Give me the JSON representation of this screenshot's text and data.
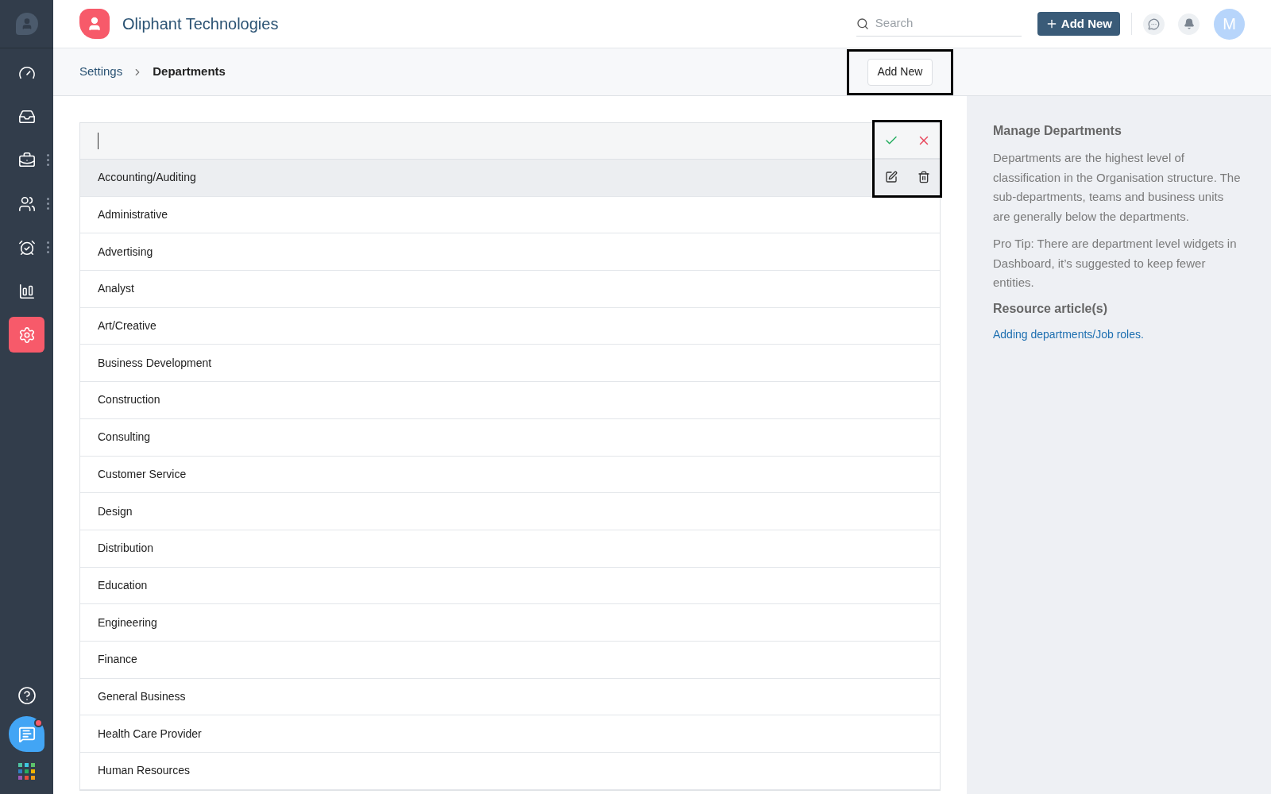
{
  "sidebar": {
    "items": [
      {
        "kind": "dashboard",
        "selected": false,
        "more": false
      },
      {
        "kind": "inbox",
        "selected": false,
        "more": false
      },
      {
        "kind": "briefcase",
        "selected": false,
        "more": true
      },
      {
        "kind": "people",
        "selected": false,
        "more": true
      },
      {
        "kind": "alarm",
        "selected": false,
        "more": true
      },
      {
        "kind": "reports",
        "selected": false,
        "more": false
      },
      {
        "kind": "settings",
        "selected": true,
        "more": false
      }
    ],
    "chat_unread": true
  },
  "header": {
    "company": "Oliphant Technologies",
    "search": {
      "placeholder": "Search"
    },
    "add_button": "Add New",
    "avatar": "M"
  },
  "breadcrumb": {
    "items": [
      "Settings",
      "Departments"
    ]
  },
  "toolbar": {
    "add_button": "Add New",
    "highlighted": true
  },
  "departments": {
    "actions_highlighted": true,
    "rows": [
      {
        "name": "Accounting/Auditing",
        "hovered": true
      },
      {
        "name": "Administrative",
        "hovered": false
      },
      {
        "name": "Advertising",
        "hovered": false
      },
      {
        "name": "Analyst",
        "hovered": false
      },
      {
        "name": "Art/Creative",
        "hovered": false
      },
      {
        "name": "Business Development",
        "hovered": false
      },
      {
        "name": "Construction",
        "hovered": false
      },
      {
        "name": "Consulting",
        "hovered": false
      },
      {
        "name": "Customer Service",
        "hovered": false
      },
      {
        "name": "Design",
        "hovered": false
      },
      {
        "name": "Distribution",
        "hovered": false
      },
      {
        "name": "Education",
        "hovered": false
      },
      {
        "name": "Engineering",
        "hovered": false
      },
      {
        "name": "Finance",
        "hovered": false
      },
      {
        "name": "General Business",
        "hovered": false
      },
      {
        "name": "Health Care Provider",
        "hovered": false
      },
      {
        "name": "Human Resources",
        "hovered": false
      }
    ]
  },
  "help": {
    "title": "Manage Departments",
    "paragraphs": [
      "Departments are the highest level of classification in the Organisation structure. The sub-departments, teams and business units are generally below the departments.",
      "Pro Tip: There are department level widgets in Dashboard, it’s suggested to keep fewer entities."
    ],
    "resources_title": "Resource article(s)",
    "links": [
      "Adding departments/Job roles."
    ]
  }
}
